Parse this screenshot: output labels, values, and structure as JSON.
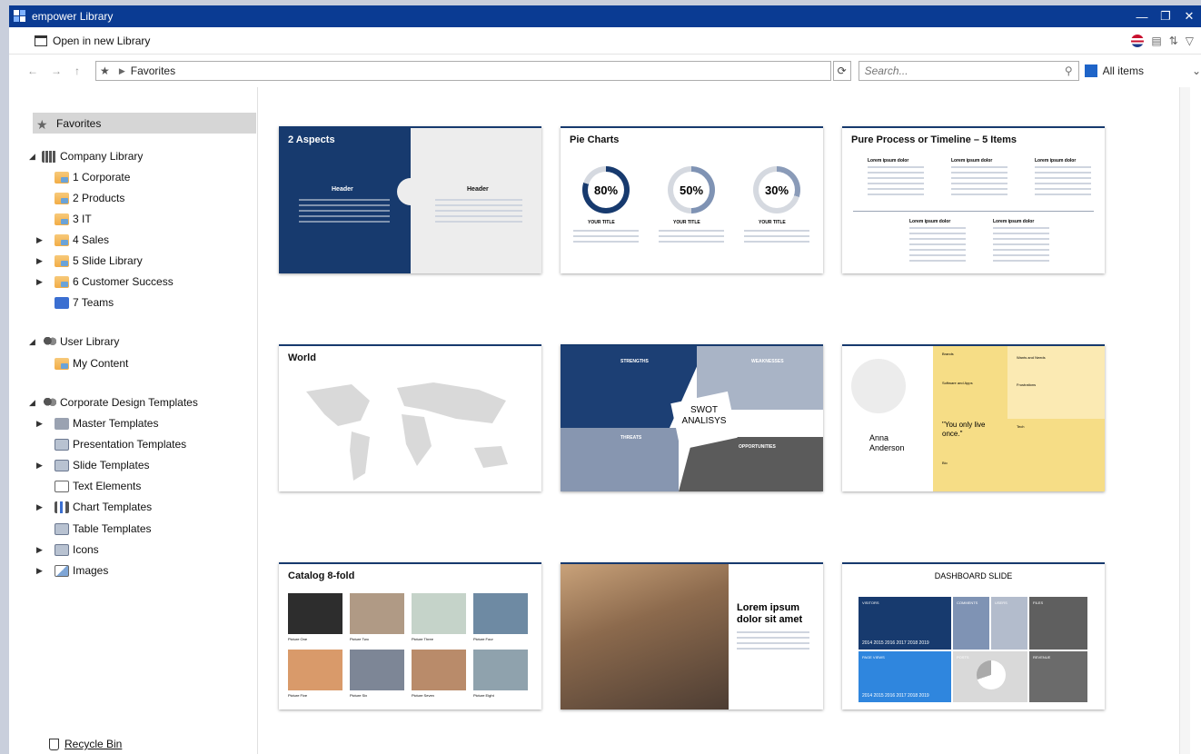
{
  "window": {
    "title": "empower Library"
  },
  "toolbar": {
    "open_new_library": "Open in new Library"
  },
  "nav": {
    "path_root": "Favorites",
    "search_placeholder": "Search...",
    "scope": "All items"
  },
  "colors": {
    "titlebar": "#0a3b93",
    "card_accent": "#173a6e",
    "selection": "#d6d6d6"
  },
  "sidebar": {
    "favorites": "Favorites",
    "company_library": "Company Library",
    "company_items": [
      "1 Corporate",
      "2 Products",
      "3 IT",
      "4 Sales",
      "5 Slide Library",
      "6 Customer Success",
      "7 Teams"
    ],
    "user_library": "User Library",
    "user_items": [
      "My Content"
    ],
    "corporate_templates": "Corporate Design Templates",
    "template_items": [
      "Master Templates",
      "Presentation Templates",
      "Slide Templates",
      "Text Elements",
      "Chart Templates",
      "Table Templates",
      "Icons",
      "Images"
    ],
    "recycle_bin": "Recycle Bin"
  },
  "cards": {
    "aspects": {
      "title": "2 Aspects",
      "header_left": "Header",
      "header_right": "Header"
    },
    "pie": {
      "title": "Pie Charts",
      "v1": "80%",
      "v2": "50%",
      "v3": "30%",
      "cap": "YOUR TITLE"
    },
    "process": {
      "title": "Pure Process or Timeline – 5 Items",
      "item": "Lorem ipsum dolor"
    },
    "world": {
      "title": "World"
    },
    "swot": {
      "title": "SWOT ANALISYS",
      "s": "STRENGTHS",
      "w": "WEAKNESSES",
      "t": "THREATS",
      "o": "OPPORTUNITIES"
    },
    "profile": {
      "name": "Anna Anderson",
      "quote": "\"You only live once.\"",
      "brands": "Brands",
      "software": "Software and Apps",
      "wants": "Wants and Needs",
      "frustrations": "Frustrations",
      "tech": "Tech",
      "bio": "Bio"
    },
    "catalog": {
      "title": "Catalog 8-fold",
      "pics": [
        "Picture One",
        "Picture Two",
        "Picture Three",
        "Picture Four",
        "Picture Five",
        "Picture Six",
        "Picture Seven",
        "Picture Eight"
      ]
    },
    "city": {
      "headline": "Lorem ipsum dolor sit amet"
    },
    "dashboard": {
      "title": "DASHBOARD SLIDE",
      "visitors": "VISITORS",
      "comments": "COMMENTS",
      "users": "USERS",
      "files": "FILES",
      "pageviews": "PAGE VIEWS",
      "posts": "POSTS",
      "revenue": "REVENUE",
      "years": "2014 2015 2016 2017 2018 2019"
    }
  }
}
